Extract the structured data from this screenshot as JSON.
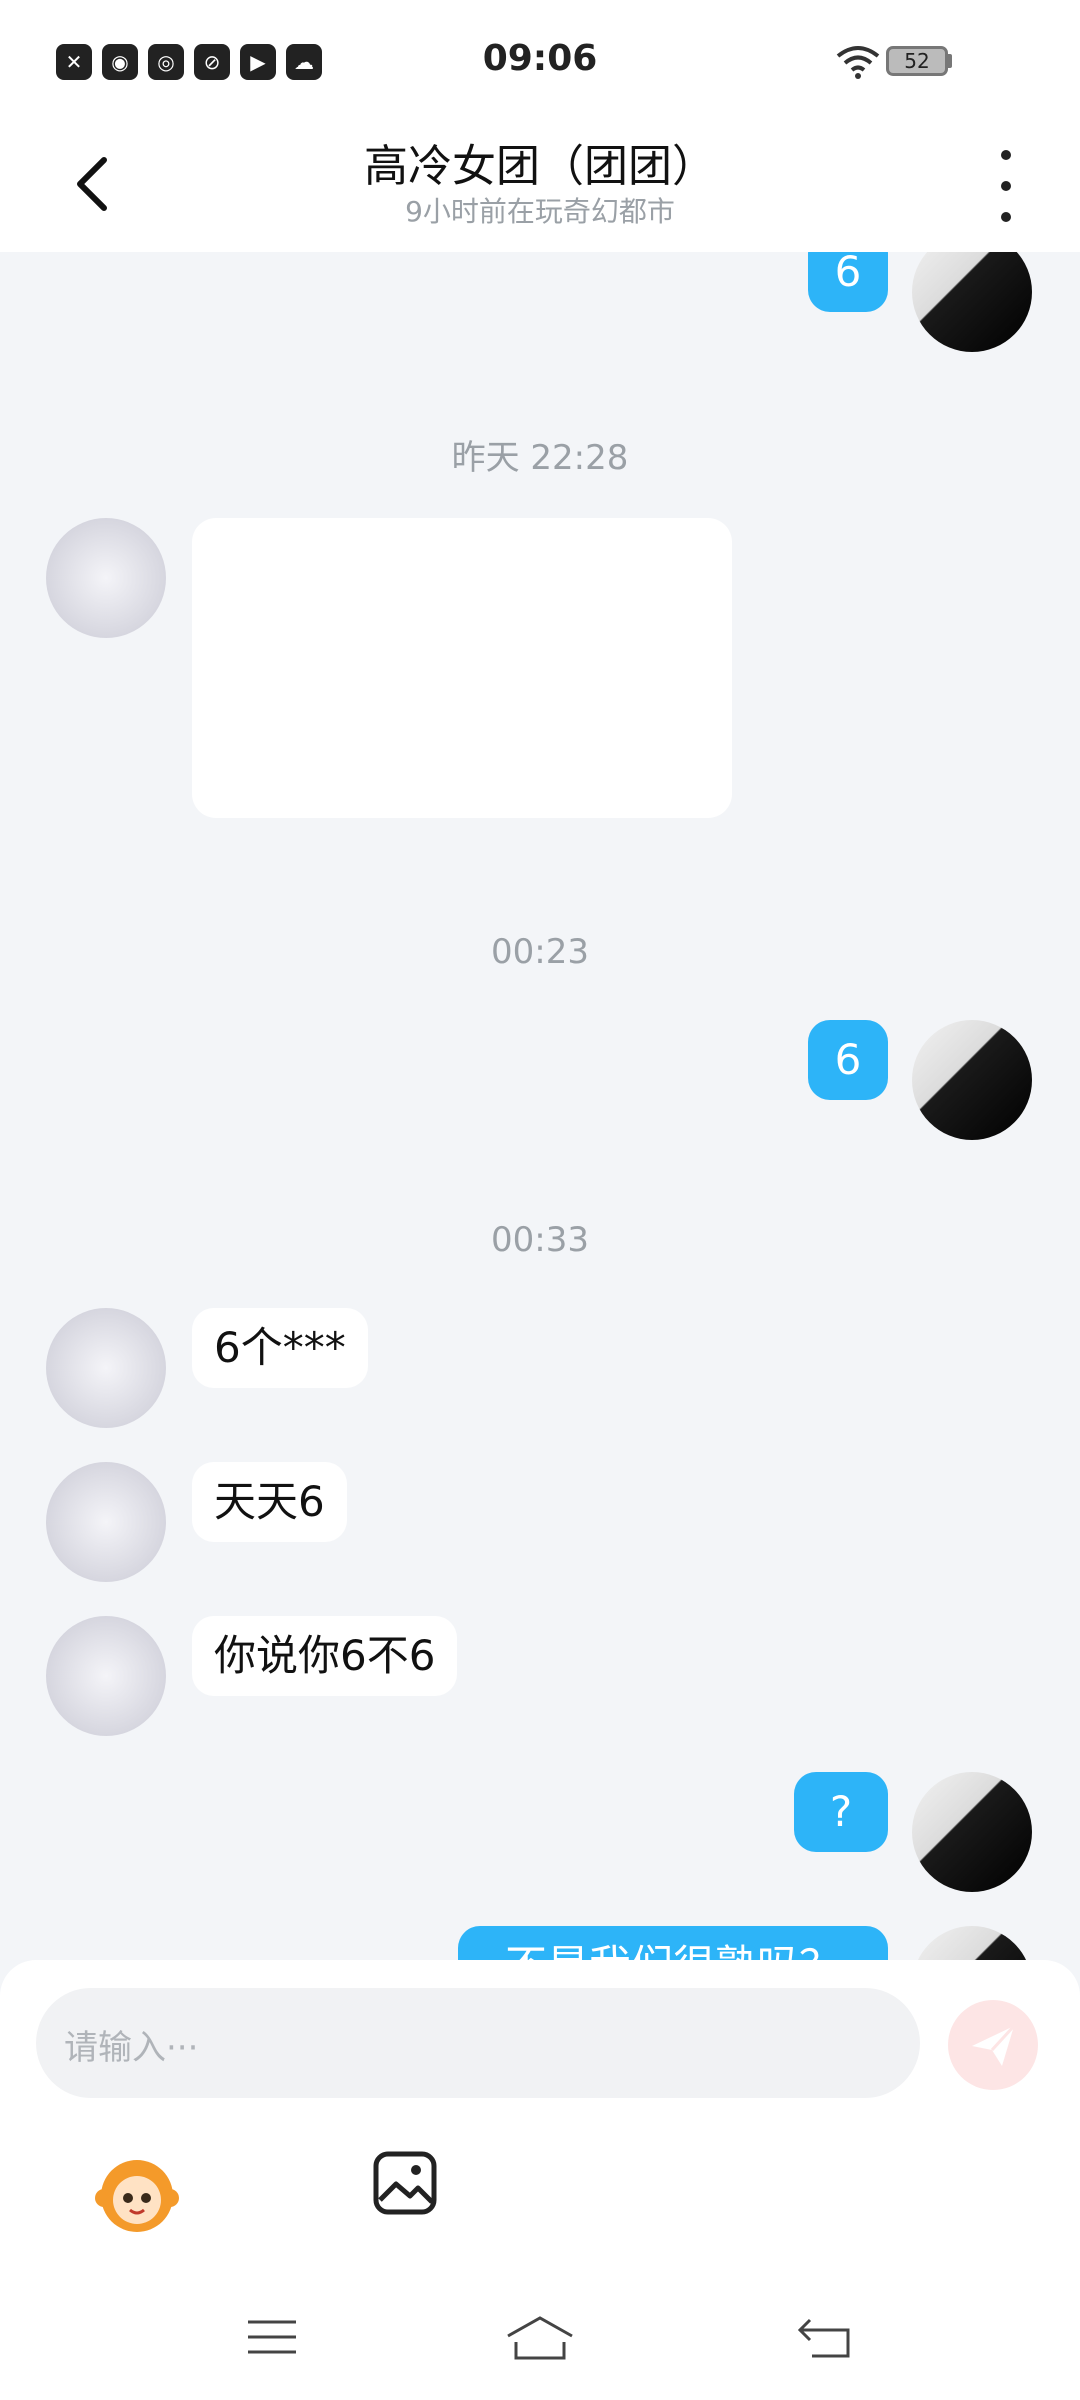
{
  "status_bar": {
    "time": "09:06",
    "battery": "52",
    "icons": [
      "file-x-icon",
      "weibo-icon",
      "app-du-icon",
      "app-leaf-icon",
      "play-icon",
      "cloud-icon"
    ]
  },
  "header": {
    "title": "高冷女团（团团）",
    "subtitle": "9小时前在玩奇幻都市"
  },
  "messages": {
    "m1_text": "6",
    "ts1": "昨天 22:28",
    "ts2": "00:23",
    "m3_text": "6",
    "ts3": "00:33",
    "m4_text": "6个***",
    "m5_text": "天天6",
    "m6_text": "你说你6不6",
    "m7_text": "?",
    "m8_text": "不是我们很熟吗？"
  },
  "composer": {
    "placeholder": "请输入···"
  },
  "colors": {
    "accent": "#2db4f8",
    "send_disabled": "#fde5e5"
  }
}
